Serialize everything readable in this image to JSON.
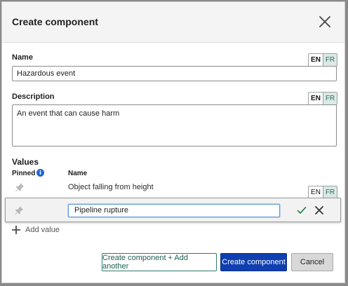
{
  "dialog": {
    "title": "Create component"
  },
  "name_field": {
    "label": "Name",
    "value": "Hazardous event",
    "lang_en": "EN",
    "lang_fr": "FR"
  },
  "description_field": {
    "label": "Description",
    "value": "An event that can cause harm",
    "lang_en": "EN",
    "lang_fr": "FR"
  },
  "values_section": {
    "title": "Values",
    "col_pinned": "Pinned",
    "col_name": "Name",
    "info_glyph": "i",
    "rows": [
      {
        "name": "Object falling from height"
      }
    ],
    "edit_row": {
      "value": "Pipeline rupture",
      "lang_en": "EN",
      "lang_fr": "FR"
    },
    "add_value_label": "Add value"
  },
  "footer": {
    "create_add_another_label": "Create component + Add another",
    "create_label": "Create component",
    "cancel_label": "Cancel"
  },
  "icons": {
    "close": "close-icon",
    "info": "info-icon",
    "pin": "pin-icon",
    "check": "check-icon",
    "cancel": "x-icon",
    "add": "plus-icon"
  },
  "colors": {
    "primary": "#0f3fb0",
    "accent_teal": "#2f7a6b",
    "info_blue": "#1e66d6",
    "check_green": "#2e8b57"
  }
}
